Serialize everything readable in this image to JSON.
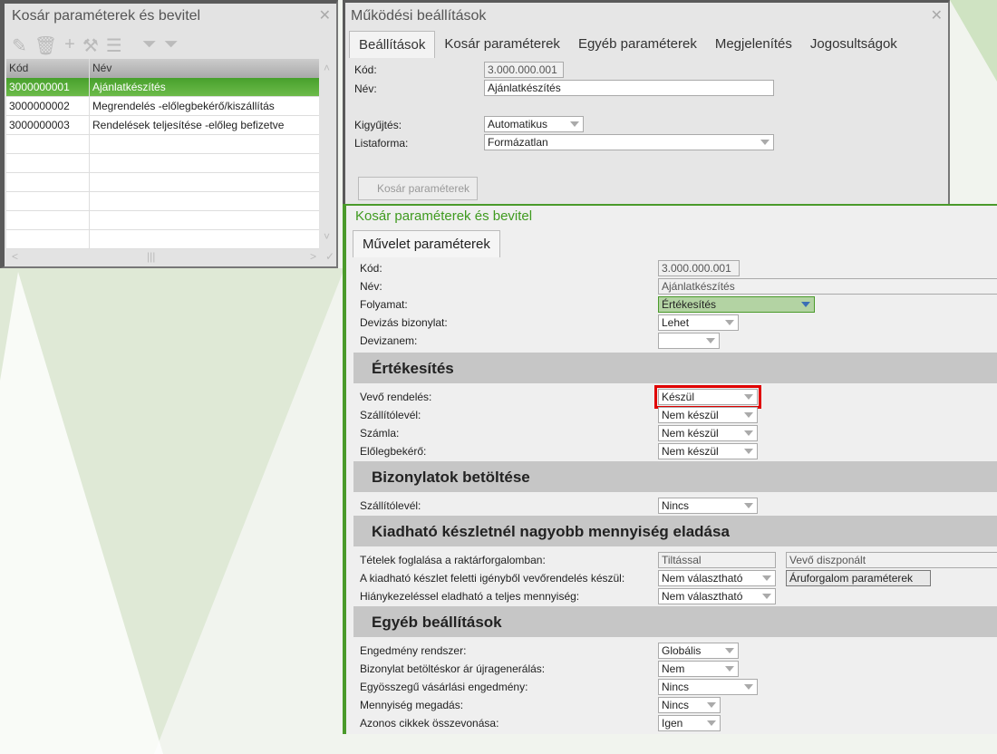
{
  "left_panel": {
    "title": "Kosár paraméterek és bevitel",
    "toolbar": [
      "pencil-icon",
      "trash-icon",
      "plus-icon",
      "tools-icon",
      "menu-icon",
      "filter-icon",
      "filter-clear-icon"
    ],
    "columns": [
      "Kód",
      "Név"
    ],
    "rows": [
      [
        "3000000001",
        "Ajánlatkészítés"
      ],
      [
        "3000000002",
        "Megrendelés -előlegbekérő/kiszállítás"
      ],
      [
        "3000000003",
        "Rendelések teljesítése -előleg befizetve"
      ]
    ],
    "selected": 0
  },
  "top_panel": {
    "title": "Működési beállítások",
    "tabs": [
      "Beállítások",
      "Kosár paraméterek",
      "Egyéb paraméterek",
      "Megjelenítés",
      "Jogosultságok"
    ],
    "kod_label": "Kód:",
    "kod_value": "3.000.000.001",
    "nev_label": "Név:",
    "nev_value": "Ajánlatkészítés",
    "kigyujtes_label": "Kigyűjtés:",
    "kigyujtes_value": "Automatikus",
    "listaforma_label": "Listaforma:",
    "listaforma_value": "Formázatlan",
    "button": "Kosár paraméterek"
  },
  "bottom_panel": {
    "title": "Kosár paraméterek és bevitel",
    "tab": "Művelet paraméterek",
    "fields": [
      {
        "label": "Kód:",
        "value": "3.000.000.001"
      },
      {
        "label": "Név:",
        "value": "Ajánlatkészítés"
      },
      {
        "label": "Folyamat:",
        "value": "Értékesítés"
      },
      {
        "label": "Devizás bizonylat:",
        "value": "Lehet"
      },
      {
        "label": "Devizanem:",
        "value": ""
      }
    ],
    "sections": [
      {
        "title": "Értékesítés",
        "fields": [
          {
            "label": "Vevő rendelés:",
            "value": "Készül"
          },
          {
            "label": "Szállítólevél:",
            "value": "Nem készül"
          },
          {
            "label": "Számla:",
            "value": "Nem készül"
          },
          {
            "label": "Előlegbekérő:",
            "value": "Nem készül"
          }
        ]
      },
      {
        "title": "Bizonylatok betöltése",
        "fields": [
          {
            "label": "Szállítólevél:",
            "value": "Nincs"
          }
        ]
      },
      {
        "title": "Kiadható készletnél nagyobb mennyiség eladása",
        "fields": [
          {
            "label": "Tételek foglalása a raktárforgalomban:",
            "value": "Tiltással",
            "extra": "Vevő diszponált"
          },
          {
            "label": "A kiadható készlet feletti igényből vevőrendelés készül:",
            "value": "Nem választható",
            "button": "Áruforgalom paraméterek"
          },
          {
            "label": "Hiánykezeléssel eladható a teljes mennyiség:",
            "value": "Nem választható"
          }
        ]
      },
      {
        "title": "Egyéb beállítások",
        "fields": [
          {
            "label": "Engedmény rendszer:",
            "value": "Globális"
          },
          {
            "label": "Bizonylat betöltéskor ár újragenerálás:",
            "value": "Nem"
          },
          {
            "label": "Egyösszegű vásárlási engedmény:",
            "value": "Nincs"
          },
          {
            "label": "Mennyiség megadás:",
            "value": "Nincs"
          },
          {
            "label": "Azonos cikkek összevonása:",
            "value": "Igen"
          }
        ]
      }
    ]
  },
  "colors": {
    "accent": "#4a9a2a",
    "highlight": "#e00000"
  }
}
